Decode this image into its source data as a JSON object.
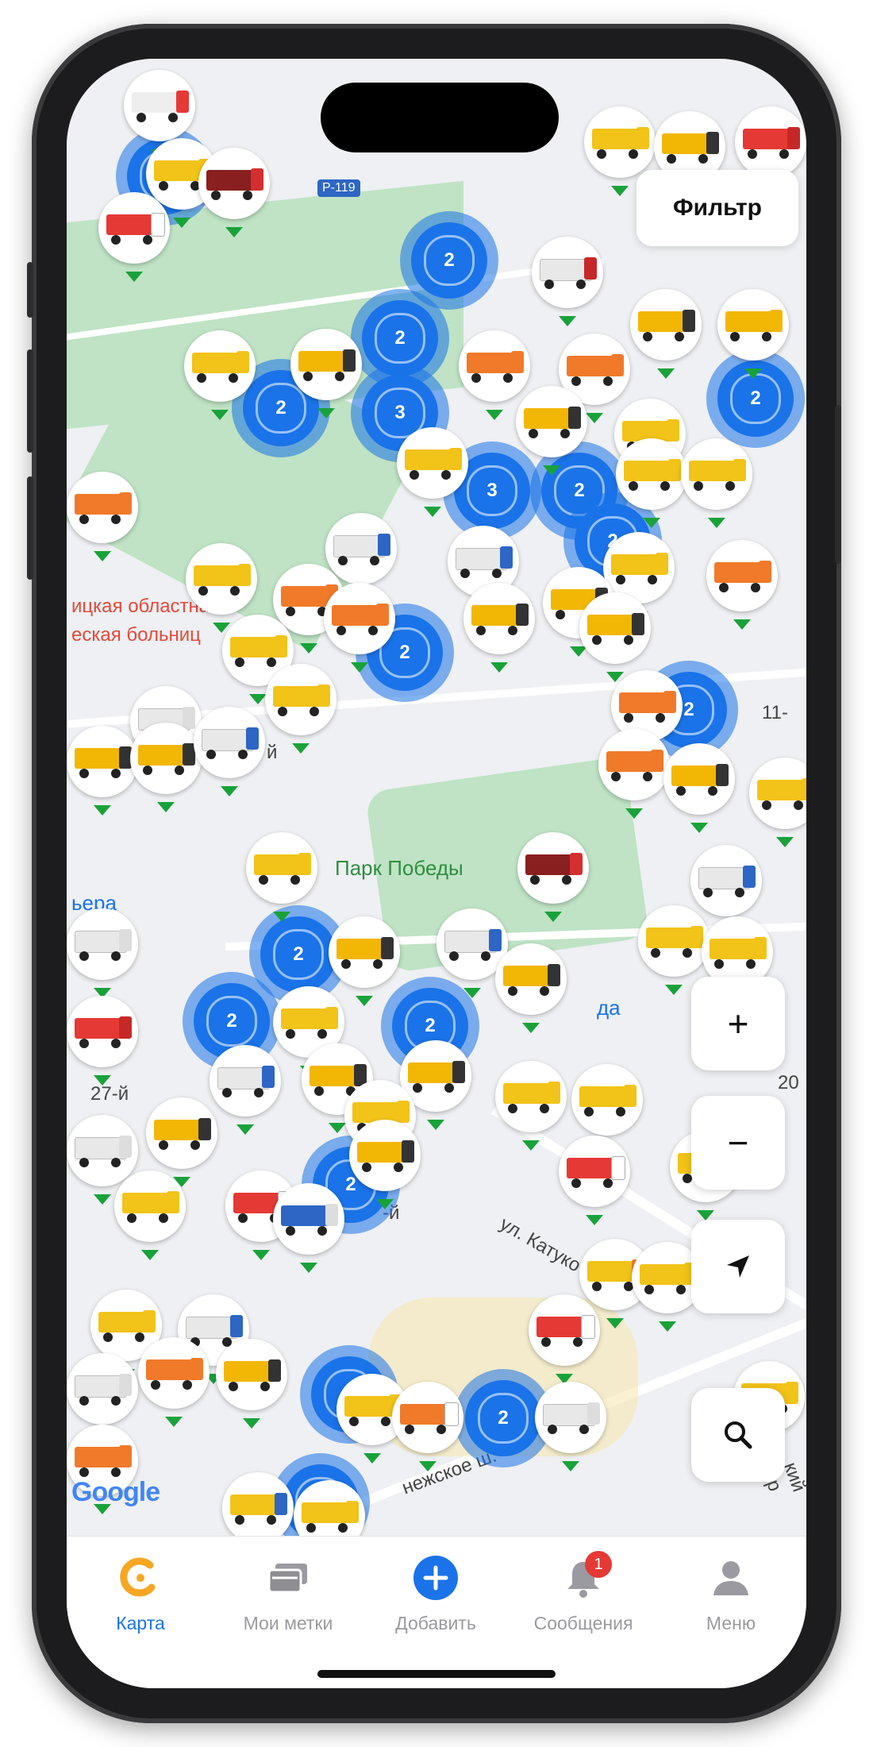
{
  "map": {
    "filter_label": "Фильтр",
    "road_shield": "Р-119",
    "labels": {
      "hospital_line1": "ицкая областна",
      "hospital_line2": "еская больниц",
      "park": "Парк Победы",
      "street_katukova": "ул. Катуко",
      "street_snezhskoe": "нежское ш.",
      "vera": "ьера",
      "right_11": "11-",
      "right_20": "20",
      "n27": "27-й",
      "letter_y": "й",
      "da": "да",
      "dash_y": "-й",
      "prosp": "кий пр"
    },
    "google_logo": "Google",
    "clusters": [
      {
        "count": "2"
      },
      {
        "count": "2"
      },
      {
        "count": "2"
      },
      {
        "count": "2"
      },
      {
        "count": "3"
      },
      {
        "count": "3"
      },
      {
        "count": "2"
      },
      {
        "count": "2"
      },
      {
        "count": "2"
      },
      {
        "count": "2"
      },
      {
        "count": "2"
      },
      {
        "count": "2"
      },
      {
        "count": "2"
      },
      {
        "count": "2"
      },
      {
        "count": "2"
      },
      {
        "count": "2"
      },
      {
        "count": "2"
      },
      {
        "count": "2"
      }
    ],
    "controls": {
      "zoom_in": "+",
      "zoom_out": "−"
    }
  },
  "tabbar": {
    "tabs": [
      {
        "label": "Карта",
        "icon": "map-logo-icon",
        "active": true
      },
      {
        "label": "Мои метки",
        "icon": "cards-icon"
      },
      {
        "label": "Добавить",
        "icon": "add-icon"
      },
      {
        "label": "Сообщения",
        "icon": "bell-icon",
        "badge": "1"
      },
      {
        "label": "Меню",
        "icon": "user-icon"
      }
    ]
  },
  "colors": {
    "accent": "#1a73e8",
    "active_logo": "#f5a623",
    "badge": "#e53935",
    "pin_marker": "#19a23a"
  }
}
